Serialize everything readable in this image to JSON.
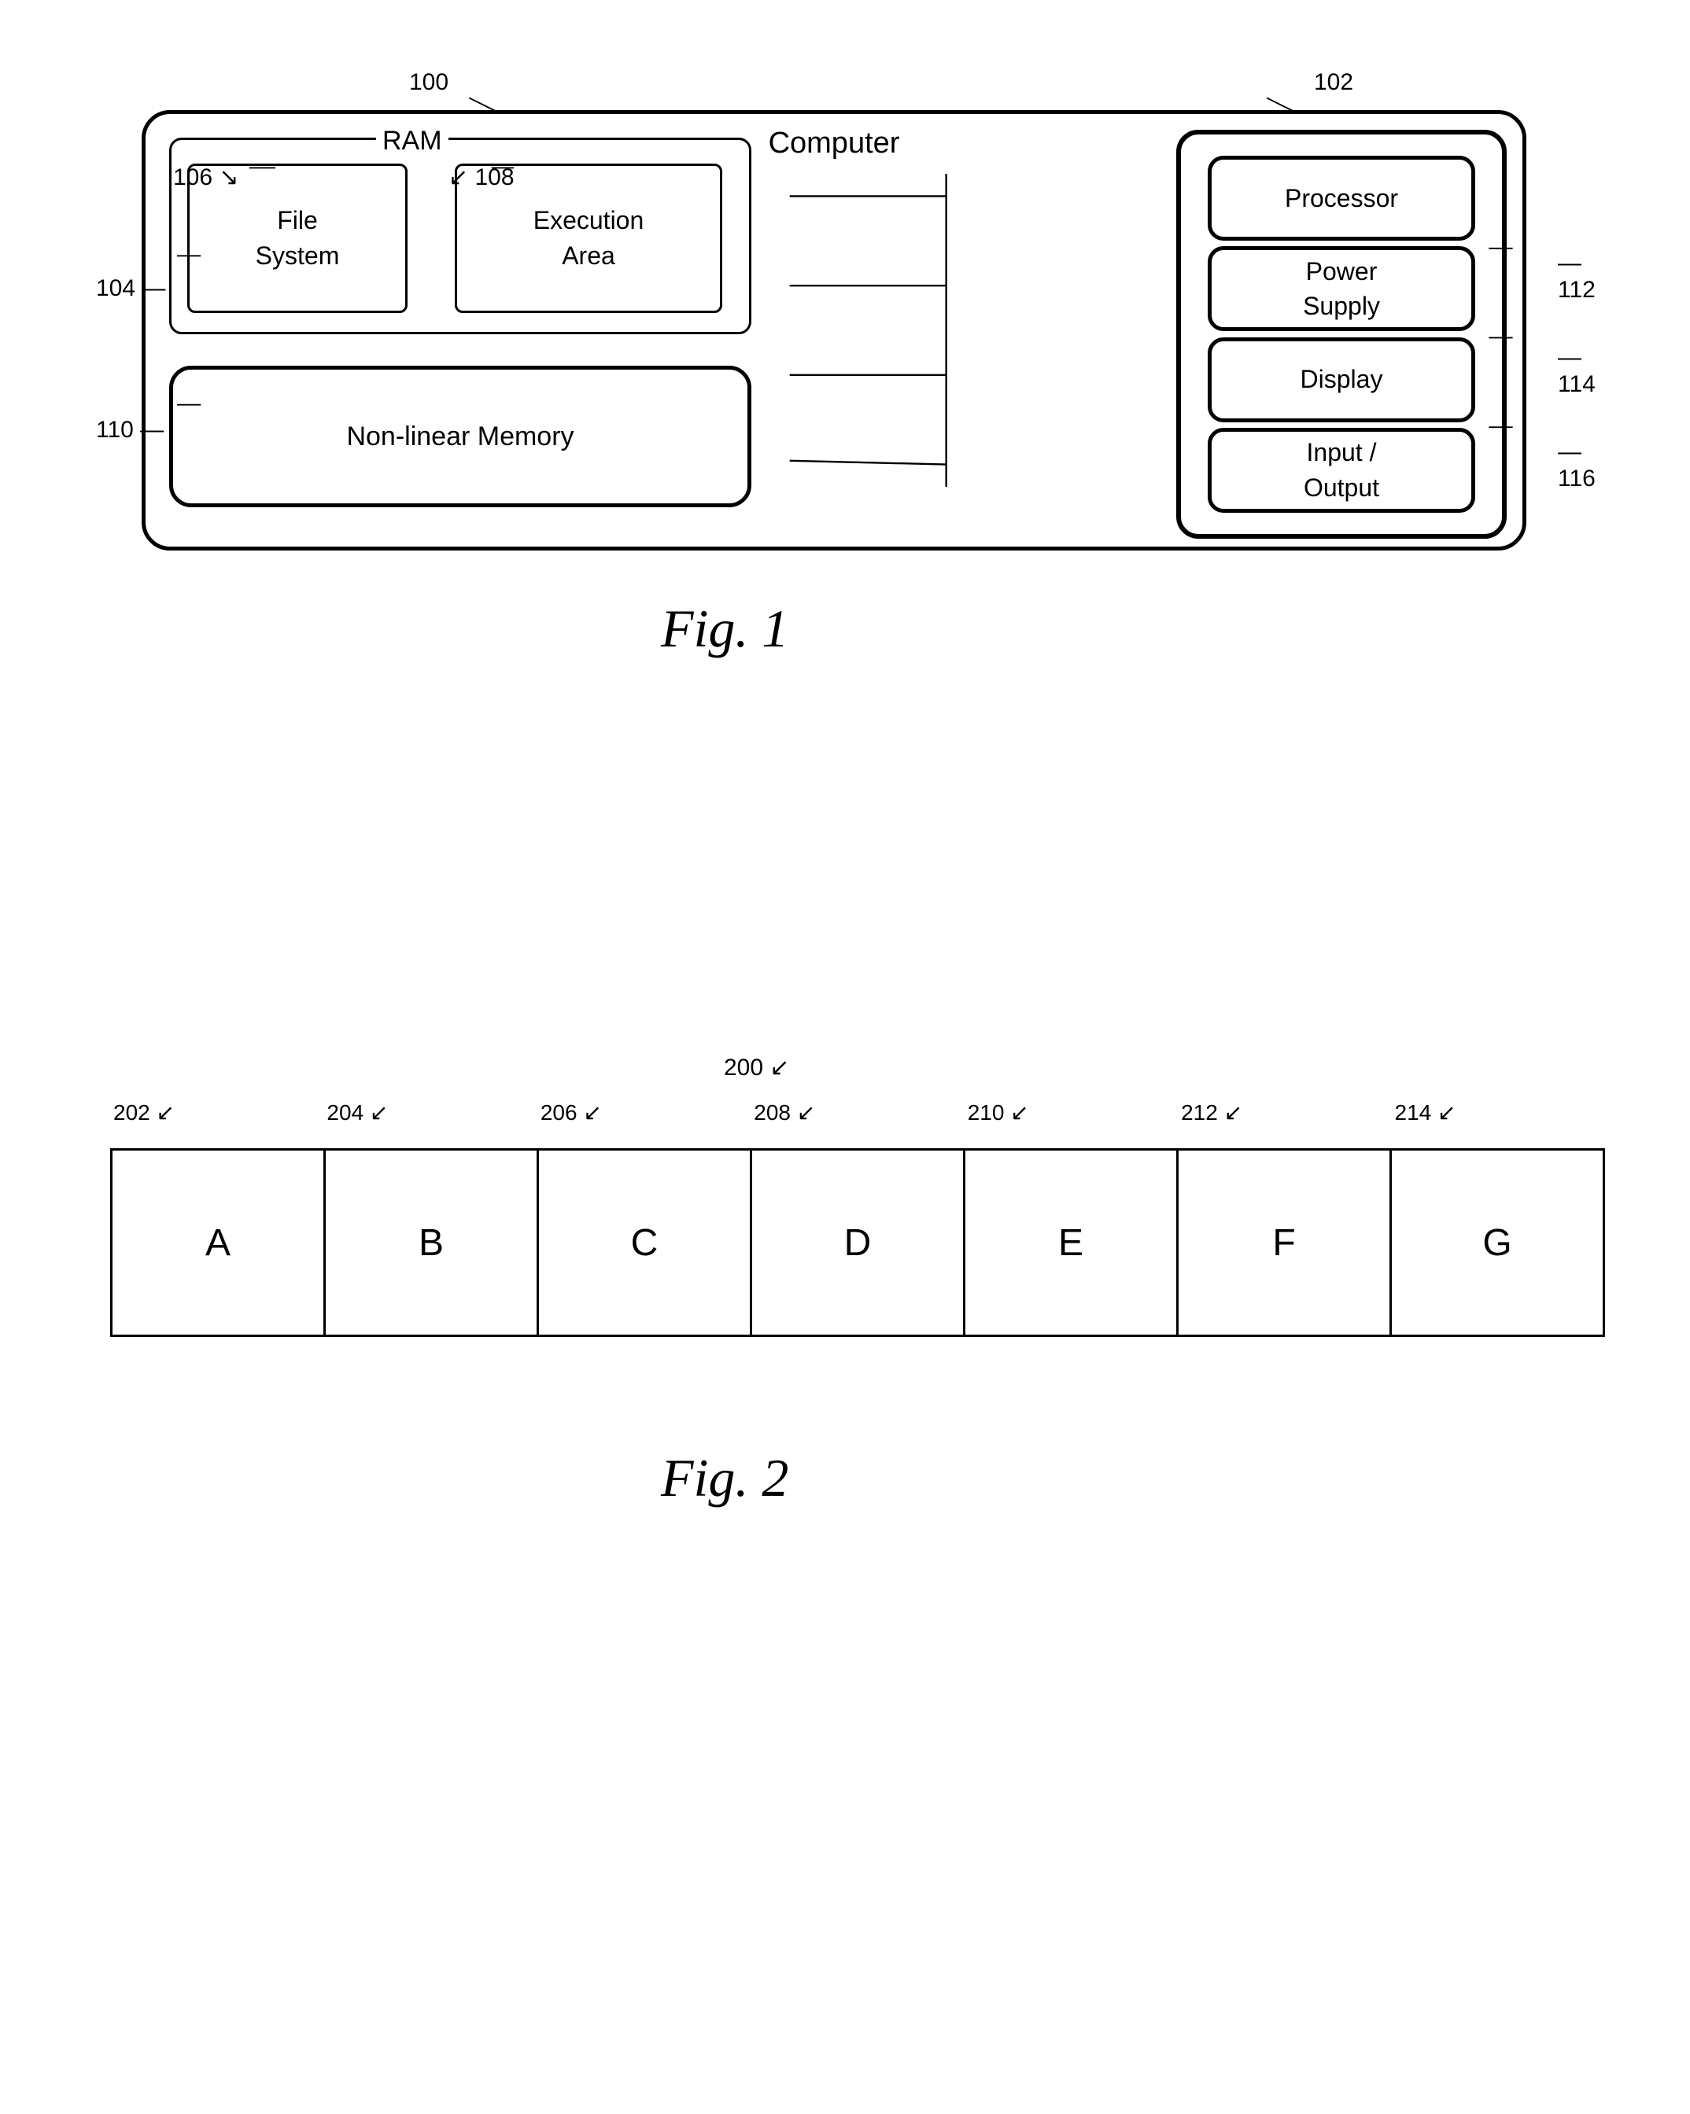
{
  "fig1": {
    "title": "Fig. 1",
    "refs": {
      "r100": "100",
      "r102": "102",
      "r104": "104",
      "r106": "106",
      "r108": "108",
      "r110": "110",
      "r112": "112",
      "r114": "114",
      "r116": "116"
    },
    "labels": {
      "computer": "Computer",
      "ram": "RAM",
      "fileSystem": "File\nSystem",
      "executionArea": "Execution\nArea",
      "nonlinearMemory": "Non-linear Memory",
      "processor": "Processor",
      "powerSupply": "Power\nSupply",
      "display": "Display",
      "inputOutput": "Input /\nOutput"
    }
  },
  "fig2": {
    "title": "Fig. 2",
    "refs": {
      "r200": "200",
      "r202": "202",
      "r204": "204",
      "r206": "206",
      "r208": "208",
      "r210": "210",
      "r212": "212",
      "r214": "214"
    },
    "cells": [
      "A",
      "B",
      "C",
      "D",
      "E",
      "F",
      "G"
    ]
  }
}
